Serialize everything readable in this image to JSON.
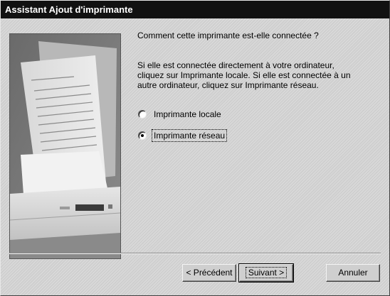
{
  "window": {
    "title": "Assistant Ajout d'imprimante"
  },
  "question": "Comment cette imprimante est-elle connectée ?",
  "instructions": "Si elle est connectée directement à votre ordinateur,\ncliquez sur Imprimante locale. Si elle est connectée à un\nautre ordinateur, cliquez sur Imprimante réseau.",
  "options": {
    "local": {
      "label": "Imprimante locale",
      "checked": false
    },
    "network": {
      "label": "Imprimante réseau",
      "checked": true
    }
  },
  "buttons": {
    "back": "< Précédent",
    "next": "Suivant >",
    "cancel": "Annuler"
  },
  "colors": {
    "titlebar": "#111111",
    "dialog": "#cfcfcf"
  }
}
